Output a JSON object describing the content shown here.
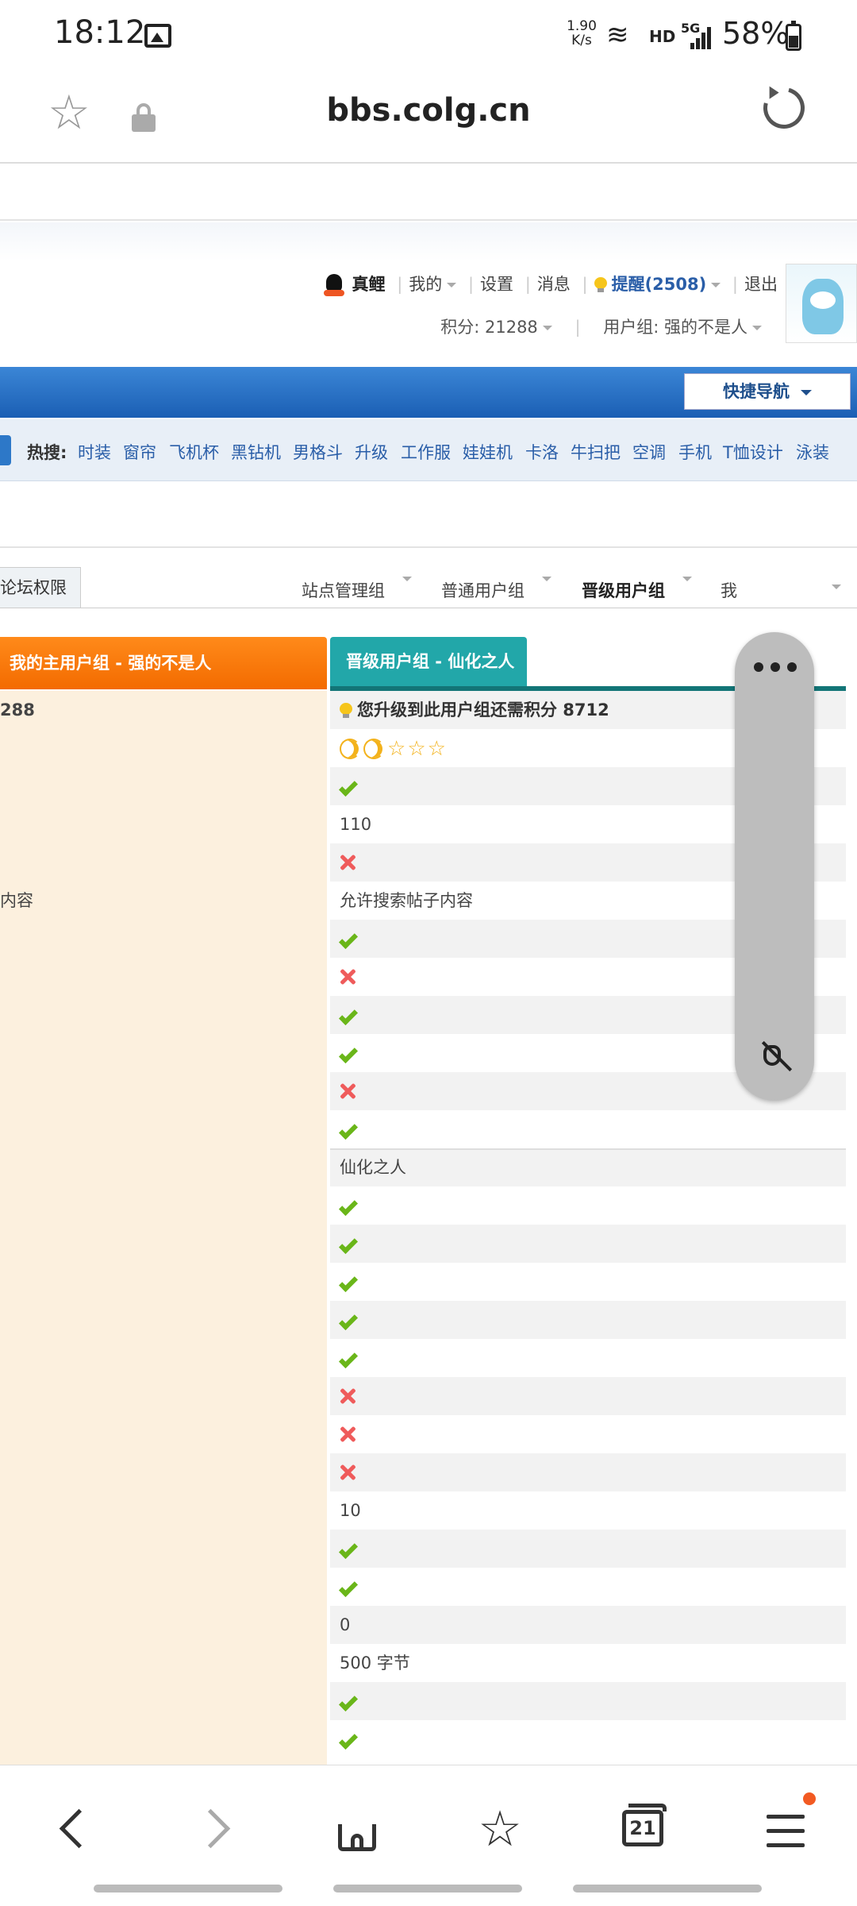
{
  "status": {
    "time": "18:12",
    "speed_top": "1.90",
    "speed_unit": "K/s",
    "wifi_badge": "6",
    "hd": "HD",
    "signal": "5G",
    "battery": "58%"
  },
  "urlbar": {
    "url": "bbs.colg.cn",
    "icons": [
      "star-icon",
      "lock-icon",
      "reload-icon"
    ]
  },
  "user": {
    "name": "真鲤",
    "my": "我的",
    "settings": "设置",
    "messages": "消息",
    "reminder": "提醒(2508)",
    "logout": "退出",
    "points": "积分: 21288",
    "group": "用户组: 强的不是人"
  },
  "quick_nav": "快捷导航",
  "hot": {
    "label": "热搜:",
    "keywords": [
      "时装",
      "窗帘",
      "飞机杯",
      "黑钻机",
      "男格斗",
      "升级",
      "工作服",
      "娃娃机",
      "卡洛",
      "牛扫把",
      "空调",
      "手机",
      "T恤设计",
      "泳装"
    ]
  },
  "tabs": {
    "left": "论坛权限",
    "groups": [
      "站点管理组",
      "普通用户组",
      "晋级用户组",
      "我"
    ]
  },
  "table": {
    "left_header": "我的主用户组 - 强的不是人",
    "right_header": "晋级用户组 - 仙化之人",
    "left_first": "288",
    "left_search": "内容",
    "upgrade_note": "您升级到此用户组还需积分 8712",
    "rows": [
      {
        "type": "level"
      },
      {
        "type": "ok"
      },
      {
        "type": "text",
        "value": "110"
      },
      {
        "type": "no"
      },
      {
        "type": "text",
        "value": "允许搜索帖子内容"
      },
      {
        "type": "ok"
      },
      {
        "type": "no"
      },
      {
        "type": "ok"
      },
      {
        "type": "ok"
      },
      {
        "type": "no"
      },
      {
        "type": "ok"
      },
      {
        "type": "text",
        "value": "仙化之人"
      },
      {
        "type": "ok"
      },
      {
        "type": "ok"
      },
      {
        "type": "ok"
      },
      {
        "type": "ok"
      },
      {
        "type": "ok"
      },
      {
        "type": "no"
      },
      {
        "type": "no"
      },
      {
        "type": "no"
      },
      {
        "type": "text",
        "value": "10"
      },
      {
        "type": "ok"
      },
      {
        "type": "ok"
      },
      {
        "type": "text",
        "value": "0"
      },
      {
        "type": "text",
        "value": "500 字节"
      },
      {
        "type": "ok"
      },
      {
        "type": "ok"
      }
    ]
  },
  "colors": {
    "accent_blue": "#1b5fb4",
    "orange_header": "#f36b00",
    "teal_header": "#22a7a9",
    "ok_green": "#6ab619",
    "no_red": "#ef5b5b"
  },
  "bottom_nav": {
    "tabs_count": "21",
    "icons": [
      "back-icon",
      "forward-icon",
      "home-icon",
      "bookmarks-icon",
      "tabs-icon",
      "menu-icon"
    ]
  }
}
